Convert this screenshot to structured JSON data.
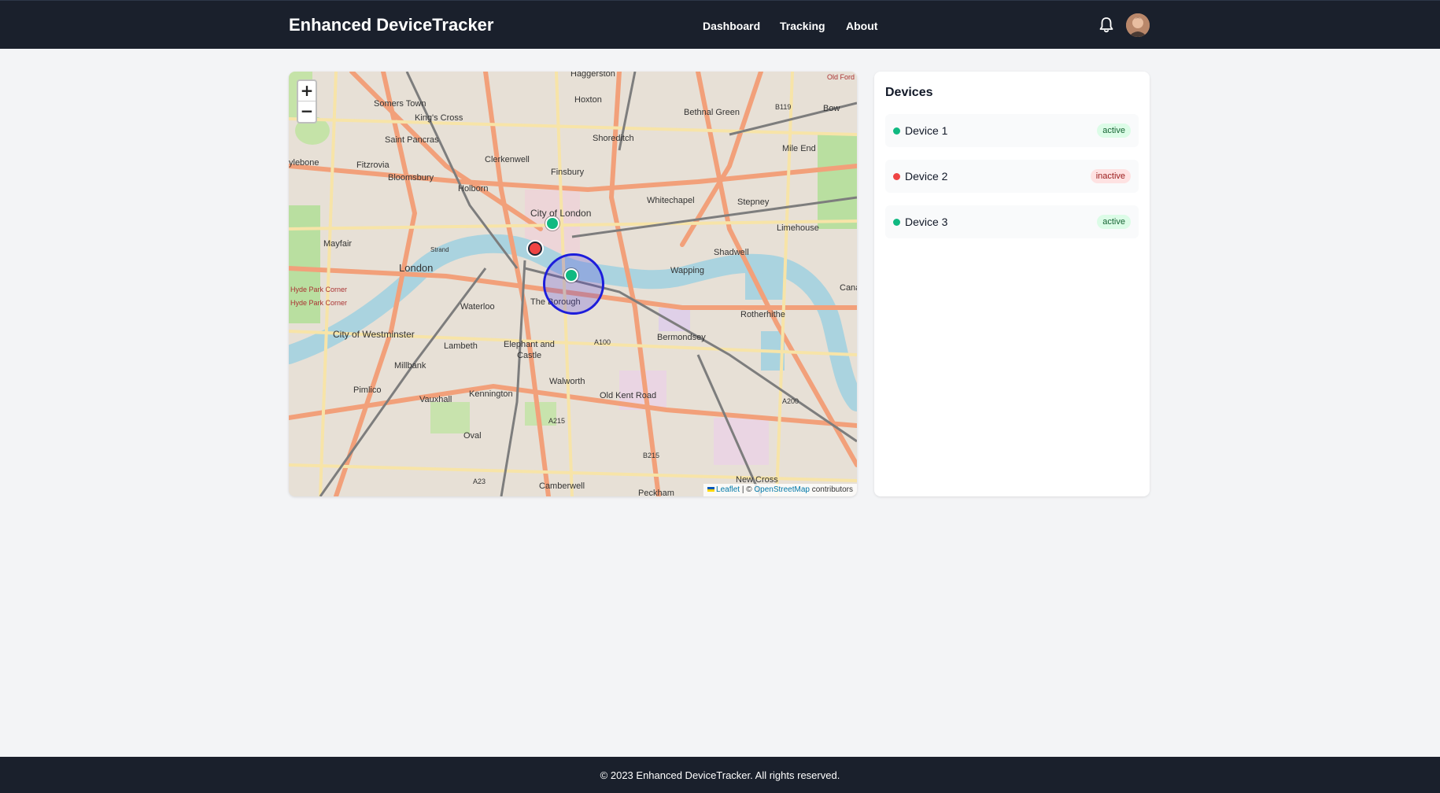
{
  "header": {
    "brand": "Enhanced DeviceTracker",
    "nav": [
      {
        "label": "Dashboard"
      },
      {
        "label": "Tracking"
      },
      {
        "label": "About"
      }
    ],
    "icons": {
      "notifications": "bell-icon",
      "profile": "avatar"
    }
  },
  "map": {
    "zoom_in": "+",
    "zoom_out": "−",
    "attribution": {
      "leaflet": "Leaflet",
      "separator": " | © ",
      "osm": "OpenStreetMap",
      "suffix": " contributors"
    },
    "labels": [
      {
        "text": "Haggerston"
      },
      {
        "text": "Somers Town"
      },
      {
        "text": "Hoxton"
      },
      {
        "text": "King's Cross"
      },
      {
        "text": "Bethnal Green"
      },
      {
        "text": "B119"
      },
      {
        "text": "Bow"
      },
      {
        "text": "Old Ford"
      },
      {
        "text": "Saint Pancras"
      },
      {
        "text": "Shoreditch"
      },
      {
        "text": "Mile End"
      },
      {
        "text": "ylebone"
      },
      {
        "text": "Fitzrovia"
      },
      {
        "text": "Clerkenwell"
      },
      {
        "text": "Finsbury"
      },
      {
        "text": "Bloomsbury"
      },
      {
        "text": "Whitechapel"
      },
      {
        "text": "Stepney"
      },
      {
        "text": "Holborn"
      },
      {
        "text": "City of London"
      },
      {
        "text": "Limehouse"
      },
      {
        "text": "Mayfair"
      },
      {
        "text": "Strand"
      },
      {
        "text": "Shadwell"
      },
      {
        "text": "London"
      },
      {
        "text": "Wapping"
      },
      {
        "text": "Hyde Park Corner"
      },
      {
        "text": "Waterloo"
      },
      {
        "text": "The Borough"
      },
      {
        "text": "Rotherhithe"
      },
      {
        "text": "Cana"
      },
      {
        "text": "City of Westminster"
      },
      {
        "text": "Lambeth"
      },
      {
        "text": "Elephant and"
      },
      {
        "text": "Castle"
      },
      {
        "text": "Bermondsey"
      },
      {
        "text": "A100"
      },
      {
        "text": "Millbank"
      },
      {
        "text": "Walworth"
      },
      {
        "text": "Pimlico"
      },
      {
        "text": "Kennington"
      },
      {
        "text": "Old Kent Road"
      },
      {
        "text": "Vauxhall"
      },
      {
        "text": "A200"
      },
      {
        "text": "A215"
      },
      {
        "text": "Oval"
      },
      {
        "text": "B215"
      },
      {
        "text": "A23"
      },
      {
        "text": "Camberwell"
      },
      {
        "text": "Peckham"
      },
      {
        "text": "New Cross"
      }
    ],
    "markers": [
      {
        "device": "Device 1",
        "status": "active"
      },
      {
        "device": "Device 2",
        "status": "inactive"
      },
      {
        "device": "Device 3",
        "status": "active"
      }
    ]
  },
  "panel": {
    "title": "Devices",
    "devices": [
      {
        "name": "Device 1",
        "status": "active"
      },
      {
        "name": "Device 2",
        "status": "inactive"
      },
      {
        "name": "Device 3",
        "status": "active"
      }
    ]
  },
  "colors": {
    "active": "#10b981",
    "inactive": "#ef4444",
    "active_badge_bg": "#dcfce7",
    "active_badge_text": "#166534",
    "inactive_badge_bg": "#fee2e2",
    "inactive_badge_text": "#991b1b",
    "header_bg": "#1a202c",
    "radius_stroke": "#1d1ddb"
  },
  "footer": {
    "text": "© 2023 Enhanced DeviceTracker. All rights reserved."
  }
}
